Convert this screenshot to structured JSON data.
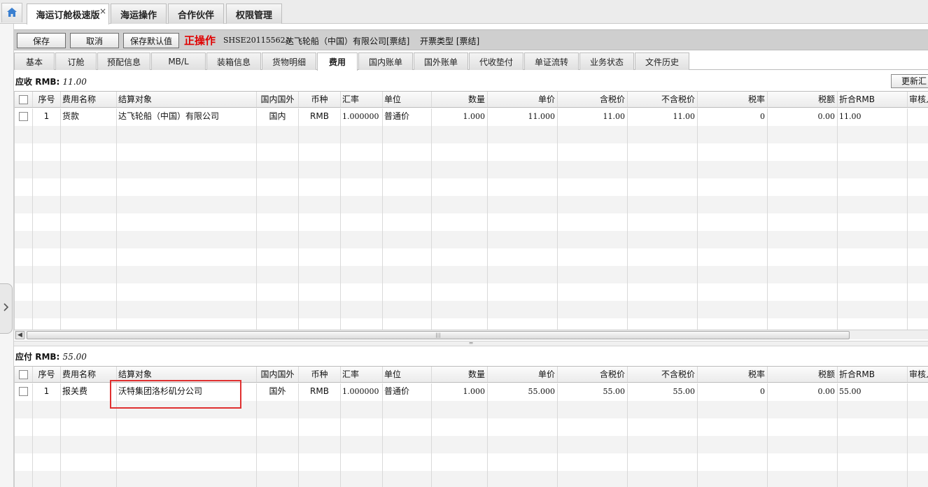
{
  "top_tabs": [
    {
      "label": "海运订舱极速版",
      "active": true,
      "closable": true
    },
    {
      "label": "海运操作"
    },
    {
      "label": "合作伙伴"
    },
    {
      "label": "权限管理"
    }
  ],
  "close_glyph": "×",
  "toolbar": {
    "save": "保存",
    "cancel": "取消",
    "save_default": "保存默认值",
    "operation_label": "正操作",
    "reference_no": "SHSE20115562A",
    "company": "达飞轮船（中国）有限公司[票结]",
    "invoice_type": "开票类型 [票结]"
  },
  "sub_tabs": [
    "基本",
    "订舱",
    "预配信息",
    "MB/L",
    "装箱信息",
    "货物明细",
    "费用",
    "国内账单",
    "国外账单",
    "代收垫付",
    "单证流转",
    "业务状态",
    "文件历史"
  ],
  "active_sub_tab": "费用",
  "update_button": "更新汇",
  "columns": [
    "序号",
    "费用名称",
    "结算对象",
    "国内国外",
    "币种",
    "汇率",
    "单位",
    "数量",
    "单价",
    "含税价",
    "不含税价",
    "税率",
    "税额",
    "折合RMB",
    "审核人"
  ],
  "receivable": {
    "label": "应收",
    "currency": "RMB:",
    "amount": "11.00",
    "rows": [
      {
        "no": "1",
        "fee_name": "货款",
        "party": "达飞轮船（中国）有限公司",
        "region": "国内",
        "currency": "RMB",
        "rate": "1.000000",
        "unit": "普通价",
        "qty": "1.000",
        "unit_price": "11.000",
        "tax_incl": "11.00",
        "tax_excl": "11.00",
        "tax_rate": "0",
        "tax": "0.00",
        "rmb": "11.00",
        "auditor": ""
      }
    ]
  },
  "payable": {
    "label": "应付",
    "currency": "RMB:",
    "amount": "55.00",
    "rows": [
      {
        "no": "1",
        "fee_name": "报关费",
        "party": "沃特集团洛杉矶分公司",
        "region": "国外",
        "currency": "RMB",
        "rate": "1.000000",
        "unit": "普通价",
        "qty": "1.000",
        "unit_price": "55.000",
        "tax_incl": "55.00",
        "tax_excl": "55.00",
        "tax_rate": "0",
        "tax": "0.00",
        "rmb": "55.00",
        "auditor": ""
      }
    ]
  },
  "icons": {
    "home": "home-icon",
    "expand": "chevron-right-icon",
    "scroll_left": "arrow-left-icon",
    "scroll_grip": "grip-icon",
    "splitter_grip": "splitter-grip-icon"
  },
  "colors": {
    "operation_red": "#e00000",
    "highlight_red": "#e03030",
    "home_blue": "#3a7fd0"
  }
}
